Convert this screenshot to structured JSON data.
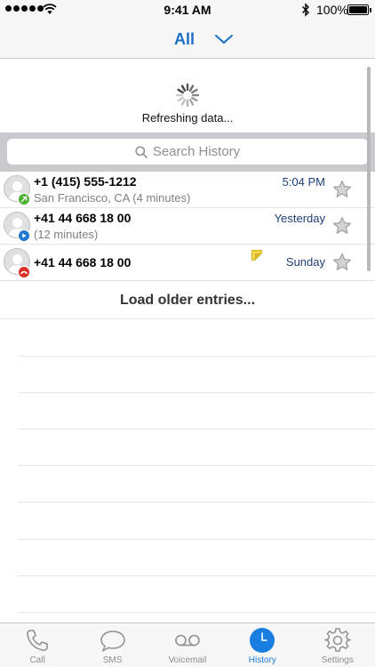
{
  "status_bar": {
    "time": "9:41 AM",
    "battery": "100%"
  },
  "header": {
    "filter_label": "All"
  },
  "refresh": {
    "text": "Refreshing data..."
  },
  "search": {
    "placeholder": "Search History"
  },
  "history": {
    "entries": [
      {
        "number": "+1 (415) 555-1212",
        "detail": "San Francisco, CA (4 minutes)",
        "time": "5:04 PM",
        "type": "outgoing"
      },
      {
        "number": "+41 44 668 18 00",
        "detail": "(12 minutes)",
        "time": "Yesterday",
        "type": "incoming"
      },
      {
        "number": "+41 44 668 18 00",
        "detail": "",
        "time": "Sunday",
        "type": "missed",
        "has_note": true
      }
    ],
    "load_more": "Load older entries..."
  },
  "tabs": [
    {
      "label": "Call",
      "icon": "phone-icon"
    },
    {
      "label": "SMS",
      "icon": "chat-bubble-icon"
    },
    {
      "label": "Voicemail",
      "icon": "voicemail-icon"
    },
    {
      "label": "History",
      "icon": "clock-icon",
      "active": true
    },
    {
      "label": "Settings",
      "icon": "gear-icon"
    }
  ],
  "colors": {
    "accent": "#1a7de0",
    "header_blue": "#1a6fc4",
    "outgoing": "#4caf2f",
    "incoming": "#2178d0",
    "missed": "#d9302a"
  }
}
